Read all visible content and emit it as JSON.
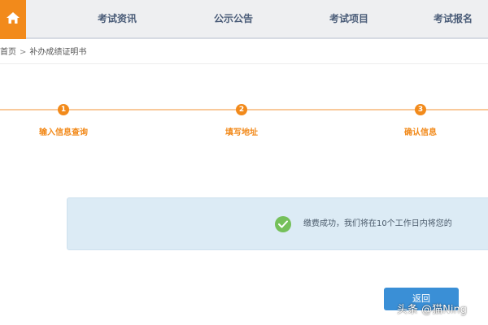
{
  "nav": {
    "home_icon": "home-icon",
    "items": [
      "考试资讯",
      "公示公告",
      "考试项目",
      "考试报名"
    ]
  },
  "breadcrumb": {
    "home": "首页",
    "separator": ">",
    "current": "补办成绩证明书"
  },
  "steps": [
    {
      "number": "1",
      "label": "输入信息查询"
    },
    {
      "number": "2",
      "label": "填写地址"
    },
    {
      "number": "3",
      "label": "确认信息"
    }
  ],
  "notice": {
    "icon": "check-circle-icon",
    "text": "缴费成功，我们将在10个工作日内将您的"
  },
  "button": {
    "label": "返回"
  },
  "watermark": {
    "text": "头条 @猫Ning"
  },
  "colors": {
    "accent": "#f28a1b",
    "nav_bg": "#eeeff1",
    "nav_text": "#4a5c78",
    "notice_bg": "#dcebf5",
    "success": "#75c05a",
    "button": "#3a8fd6"
  }
}
